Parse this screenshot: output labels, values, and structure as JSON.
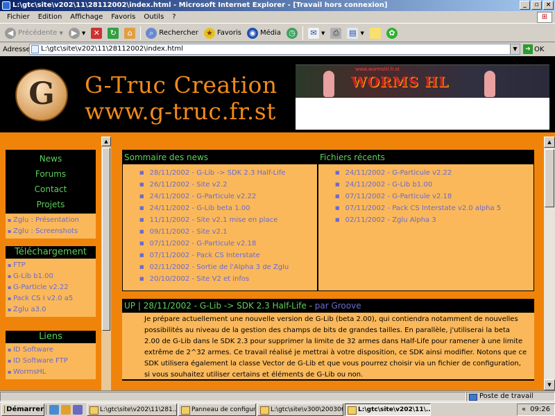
{
  "window": {
    "title": "L:\\gtc\\site\\v202\\11\\28112002\\index.html - Microsoft Internet Explorer - [Travail hors connexion]",
    "btn_min": "_",
    "btn_max": "▫",
    "btn_close": "×"
  },
  "menu": [
    "Fichier",
    "Edition",
    "Affichage",
    "Favoris",
    "Outils",
    "?"
  ],
  "toolbar": {
    "back": "Précédente",
    "search": "Rechercher",
    "favorites": "Favoris",
    "media": "Média"
  },
  "address": {
    "label": "Adresse",
    "value": "L:\\gtc\\site\\v202\\11\\28112002\\index.html",
    "go": "OK"
  },
  "site": {
    "logo_letter": "G",
    "title": "G-Truc Creation",
    "url": "www.g-truc.fr.st",
    "banner_title": "WORMS HL",
    "banner_sub": "www.wormshl.fr.st"
  },
  "sidebar": {
    "nav": [
      "News",
      "Forums",
      "Contact",
      "Projets"
    ],
    "projets": [
      "Zglu : Présentation",
      "Zglu : Screenshots"
    ],
    "download_header": "Téléchargement",
    "downloads": [
      "FTP",
      "G-Lib b1.00",
      "G-Particle v2.22",
      "Pack CS I v2.0 a5",
      "Zglu a3.0"
    ],
    "links_header": "Liens",
    "links": [
      "ID Software",
      "ID Software FTP",
      "WormsHL"
    ]
  },
  "news_summary": {
    "header": "Sommaire des news",
    "items": [
      "28/11/2002 - G-Lib -> SDK 2.3 Half-Life",
      "26/11/2002 - Site v2.2",
      "24/11/2002 - G-Particule v2.22",
      "24/11/2002 - G-Lib beta 1.00",
      "11/11/2002 - Site v2.1 mise en place",
      "09/11/2002 - Site v2.1",
      "07/11/2002 - G-Particule v2.18",
      "07/11/2002 - Pack CS Interstate",
      "02/11/2002 - Sortie de l'Alpha 3 de Zglu",
      "20/10/2002 - Site V2 et infos"
    ]
  },
  "recent_files": {
    "header": "Fichiers récents",
    "items": [
      "24/11/2002 - G-Particule v2.22",
      "24/11/2002 - G-Lib b1.00",
      "07/11/2002 - G-Particule v2.18",
      "07/11/2002 - Pack CS Interstate v2.0 alpha 5",
      "02/11/2002 - Zglu Alpha 3"
    ]
  },
  "article": {
    "header": "UP | 28/11/2002 - G-Lib -> SDK 2.3 Half-Life - ",
    "author": "par Groove",
    "body": "Je prépare actuellement une nouvelle version de G-Lib (beta 2.00), qui contiendra notamment de nouvelles possibilités au niveau de la gestion des champs de bits de grandes tailles. En parallèle, j'utiliserai la beta 2.00 de G-Lib dans le SDK 2.3 pour supprimer la limite de 32 armes dans Half-Life pour ramener à une limite extrême de 2^32 armes. Ce travail réalisé je mettrai à votre disposition, ce SDK ainsi modifier. Notons que ce SDK utilisera également la classe Vector de G-Lib et que vous pourrez choisir via un fichier de configuration, si vous souhaitez utiliser certains et éléments de G-Lib ou non."
  },
  "status": {
    "left": "",
    "zone": "Poste de travail"
  },
  "taskbar": {
    "start": "Démarrer",
    "tasks": [
      "L:\\gtc\\site\\v202\\11\\281...",
      "Panneau de configuration",
      "L:\\gtc\\site\\v300\\200306...",
      "L:\\gtc\\site\\v202\\11\\..."
    ],
    "chevron": "«",
    "clock": "09:26"
  }
}
